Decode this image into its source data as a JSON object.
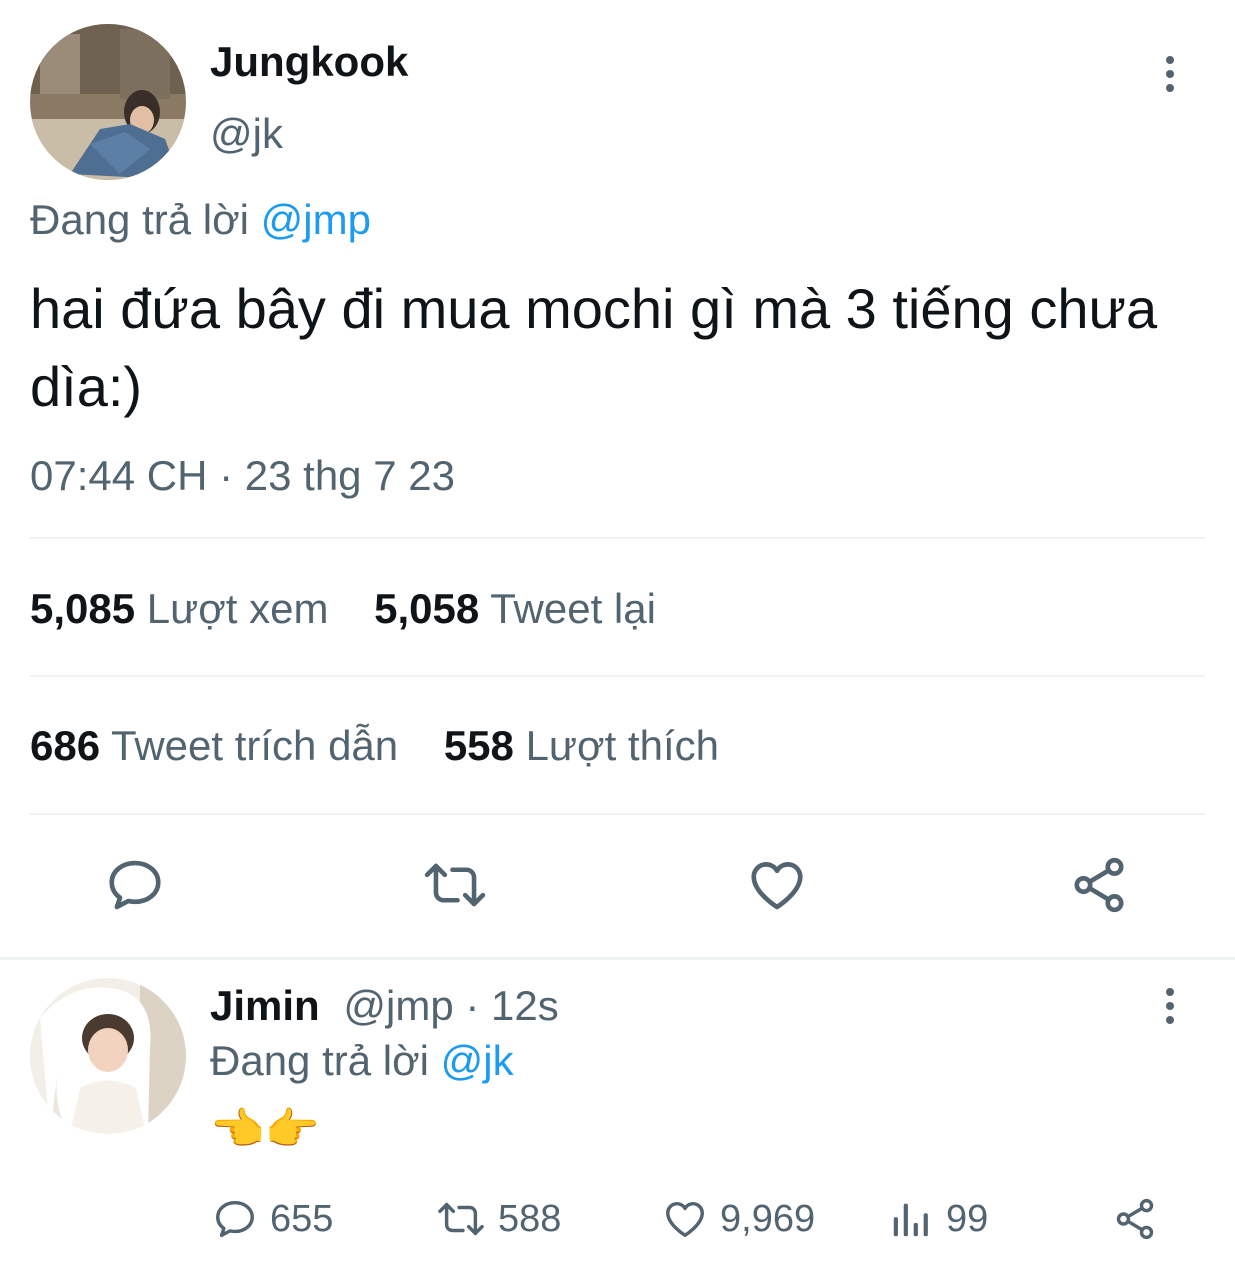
{
  "tweet": {
    "display_name": "Jungkook",
    "handle": "@jk",
    "replying_prefix": "Đang trả lời",
    "replying_to": "@jmp",
    "text": "hai đứa bây đi mua mochi gì mà 3 tiếng chưa dìa:)",
    "timestamp": "07:44 CH · 23 thg 7 23",
    "stats": {
      "views_count": "5,085",
      "views_label": "Lượt xem",
      "retweets_count": "5,058",
      "retweets_label": "Tweet lại",
      "quotes_count": "686",
      "quotes_label": "Tweet trích dẫn",
      "likes_count": "558",
      "likes_label": "Lượt thích"
    },
    "actions": [
      "reply-icon",
      "retweet-icon",
      "like-icon",
      "share-icon"
    ]
  },
  "reply": {
    "display_name": "Jimin",
    "handle": "@jmp",
    "time": " · 12s",
    "replying_prefix": "Đang trả lời",
    "replying_to": "@jk",
    "text": "👈👉",
    "counts": {
      "replies": "655",
      "retweets": "588",
      "likes": "9,969",
      "views": "99"
    }
  },
  "colors": {
    "text": "#0f1419",
    "secondary": "#536471",
    "link": "#1d9bf0",
    "divider": "#eff3f4"
  }
}
